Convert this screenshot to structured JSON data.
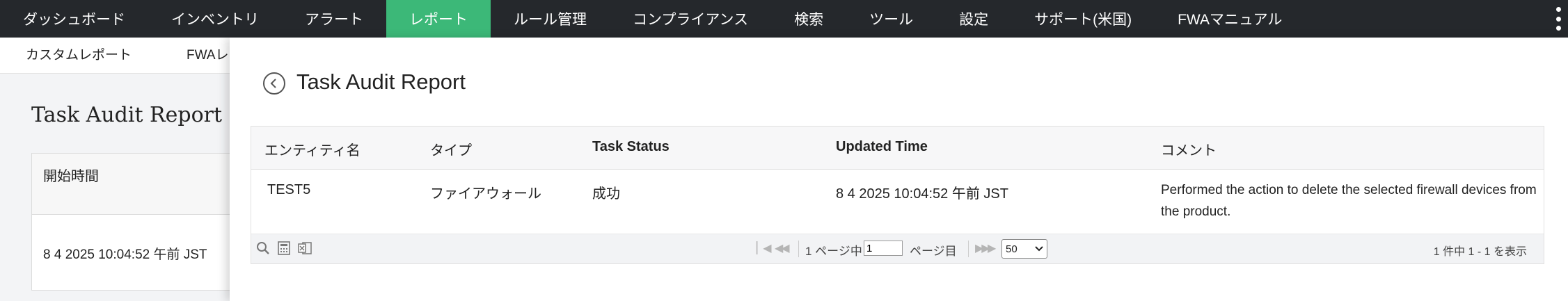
{
  "topnav": {
    "items": [
      "ダッシュボード",
      "インベントリ",
      "アラート",
      "レポート",
      "ルール管理",
      "コンプライアンス",
      "検索",
      "ツール",
      "設定",
      "サポート(米国)",
      "FWAマニュアル"
    ],
    "active_index": 3,
    "active_color": "#3cb878",
    "background": "#25282c"
  },
  "subnav": {
    "items": [
      "カスタムレポート",
      "FWAレ"
    ]
  },
  "background_page": {
    "title": "Task Audit Report",
    "column_header": "開始時間",
    "cell_value": "8 4 2025 10:04:52 午前 JST"
  },
  "panel": {
    "back_icon": "back-arrow-icon",
    "title": "Task Audit Report",
    "columns": [
      "エンティティ名",
      "タイプ",
      "Task Status",
      "Updated Time",
      "コメント"
    ],
    "rows": [
      {
        "entity": "TEST5",
        "type": "ファイアウォール",
        "status": "成功",
        "updated": "8 4 2025 10:04:52 午前 JST",
        "comment": "Performed the action to delete the selected firewall devices from the product."
      }
    ]
  },
  "pager": {
    "page_prefix": "1 ページ中",
    "page_value": "1",
    "page_suffix": "ページ目",
    "page_size": "50",
    "summary": "1 件中 1 - 1 を表示"
  }
}
